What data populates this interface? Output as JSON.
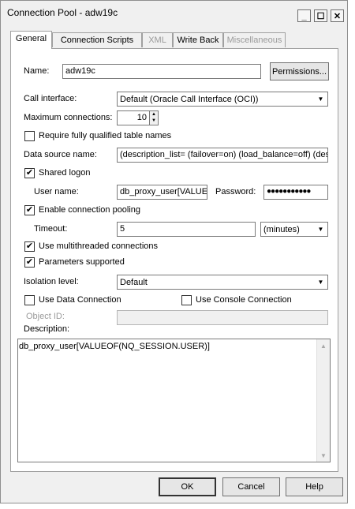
{
  "window": {
    "title": "Connection Pool - adw19c",
    "minimize_glyph": "_",
    "maximize_glyph": "☐",
    "close_glyph": "✕"
  },
  "tabs": [
    {
      "label": "General",
      "active": true,
      "enabled": true
    },
    {
      "label": "Connection Scripts",
      "active": false,
      "enabled": true
    },
    {
      "label": "XML",
      "active": false,
      "enabled": false
    },
    {
      "label": "Write Back",
      "active": false,
      "enabled": true
    },
    {
      "label": "Miscellaneous",
      "active": false,
      "enabled": false
    }
  ],
  "general": {
    "name_label": "Name:",
    "name_value": "adw19c",
    "permissions_button": "Permissions...",
    "call_interface_label": "Call interface:",
    "call_interface_value": "Default (Oracle Call Interface (OCI))",
    "max_connections_label": "Maximum connections:",
    "max_connections_value": "10",
    "require_fq_label": "Require fully qualified table names",
    "require_fq_checked": false,
    "dsn_label": "Data source name:",
    "dsn_value": "(description_list= (failover=on) (load_balance=off) (descri",
    "shared_logon_label": "Shared logon",
    "shared_logon_checked": true,
    "user_name_label": "User name:",
    "user_name_value": "db_proxy_user[VALUEO",
    "password_label": "Password:",
    "password_value": "●●●●●●●●●●●",
    "enable_pooling_label": "Enable connection pooling",
    "enable_pooling_checked": true,
    "timeout_label": "Timeout:",
    "timeout_value": "5",
    "timeout_unit": "(minutes)",
    "multithreaded_label": "Use multithreaded connections",
    "multithreaded_checked": true,
    "params_supported_label": "Parameters supported",
    "params_supported_checked": true,
    "isolation_label": "Isolation level:",
    "isolation_value": "Default",
    "use_data_conn_label": "Use Data Connection",
    "use_data_conn_checked": false,
    "use_console_conn_label": "Use Console Connection",
    "use_console_conn_checked": false,
    "object_id_label": "Object ID:",
    "object_id_value": "",
    "description_label": "Description:",
    "description_value": "db_proxy_user[VALUEOF(NQ_SESSION.USER)]"
  },
  "buttons": {
    "ok": "OK",
    "cancel": "Cancel",
    "help": "Help"
  },
  "glyphs": {
    "check": "✔",
    "dropdown": "▼",
    "spin_up": "▲",
    "spin_down": "▼",
    "scroll_up": "▲",
    "scroll_down": "▼"
  }
}
